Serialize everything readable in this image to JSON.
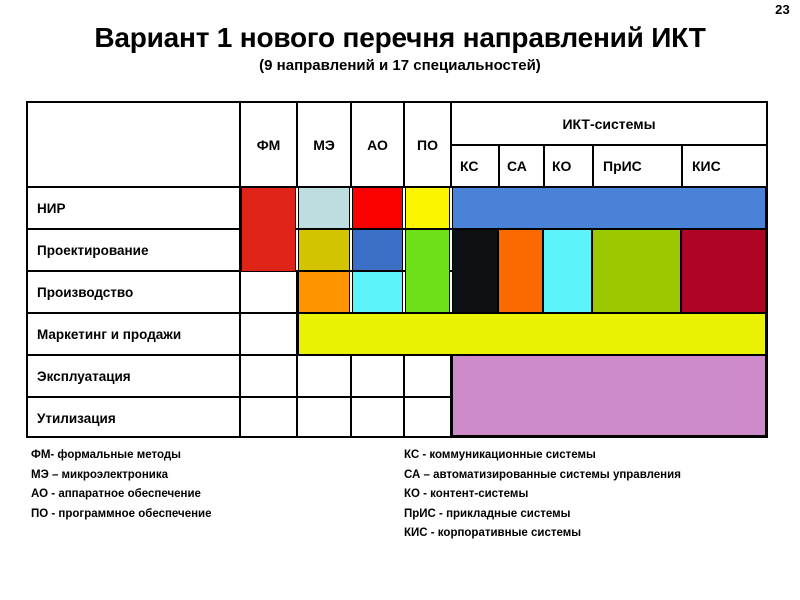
{
  "page": {
    "number": "23"
  },
  "header": {
    "title": "Вариант 1 нового перечня направлений ИКТ",
    "subtitle": "(9 направлений и 17 специальностей)"
  },
  "table": {
    "corner_label": "",
    "group_header": "ИКТ-системы",
    "columns": [
      {
        "id": "fm",
        "label": "ФМ"
      },
      {
        "id": "me",
        "label": "МЭ"
      },
      {
        "id": "ao",
        "label": "АО"
      },
      {
        "id": "po",
        "label": "ПО"
      }
    ],
    "subcolumns": [
      {
        "id": "ks",
        "label": "КС"
      },
      {
        "id": "sa",
        "label": "СА"
      },
      {
        "id": "ko",
        "label": "КО"
      },
      {
        "id": "pris",
        "label": "ПрИС"
      },
      {
        "id": "kis",
        "label": "КИС"
      }
    ],
    "rows": [
      {
        "id": "nir",
        "label": "НИР"
      },
      {
        "id": "proekt",
        "label": "Проектирование"
      },
      {
        "id": "proizvodstvo",
        "label": "Производство"
      },
      {
        "id": "marketing",
        "label": "Маркетинг и продажи"
      },
      {
        "id": "ekspluataciya",
        "label": "Эксплуатация"
      },
      {
        "id": "utilizaciya",
        "label": "Утилизация"
      }
    ],
    "blocks": [
      {
        "name": "fm-nir-proekt",
        "row": "nir",
        "col": "fm",
        "color": "#e02419"
      },
      {
        "name": "me-nir",
        "row": "nir",
        "col": "me",
        "color": "#bedde0"
      },
      {
        "name": "ao-nir",
        "row": "nir",
        "col": "ao",
        "color": "#fa0000"
      },
      {
        "name": "po-nir",
        "row": "nir",
        "col": "po",
        "color": "#fcf500"
      },
      {
        "name": "ikt-nir",
        "row": "nir",
        "col": "ikt",
        "color": "#4a82d8"
      },
      {
        "name": "me-proekt",
        "row": "proekt",
        "col": "me",
        "color": "#d4c400"
      },
      {
        "name": "ao-proekt",
        "row": "proekt",
        "col": "ao",
        "color": "#3b6fc6"
      },
      {
        "name": "po-proekt-proizv",
        "row": "proekt",
        "col": "po",
        "color": "#6ee019"
      },
      {
        "name": "ks-proekt-proizv",
        "row": "proekt",
        "col": "ks",
        "color": "#0d1114"
      },
      {
        "name": "sa-proekt-proizv",
        "row": "proekt",
        "col": "sa",
        "color": "#fb6a00"
      },
      {
        "name": "ko-proekt-proizv",
        "row": "proekt",
        "col": "ko",
        "color": "#5ef2fb"
      },
      {
        "name": "pris-proekt-proizv",
        "row": "proekt",
        "col": "pris",
        "color": "#9cc800"
      },
      {
        "name": "kis-proekt-proizv",
        "row": "proekt",
        "col": "kis",
        "color": "#b00425"
      },
      {
        "name": "me-proizvodstvo",
        "row": "proizvodstvo",
        "col": "me",
        "color": "#fd9400"
      },
      {
        "name": "ao-proizvodstvo",
        "row": "proizvodstvo",
        "col": "ao",
        "color": "#5ef2fb"
      },
      {
        "name": "marketing-band",
        "row": "marketing",
        "col": "span",
        "color": "#e9f202"
      },
      {
        "name": "ikt-ekspl-util",
        "row": "ekspluataciya",
        "col": "ikt",
        "color": "#cc8ac8"
      }
    ]
  },
  "legend_left": [
    "ФМ- формальные методы",
    "МЭ – микроэлектроника",
    "АО - аппаратное обеспечение",
    "ПО - программное обеспечение"
  ],
  "legend_right": [
    "КС - коммуникационные системы",
    "СА – автоматизированные системы управления",
    "КО - контент-системы",
    "ПрИС  - прикладные системы",
    "КИС - корпоративные системы"
  ]
}
